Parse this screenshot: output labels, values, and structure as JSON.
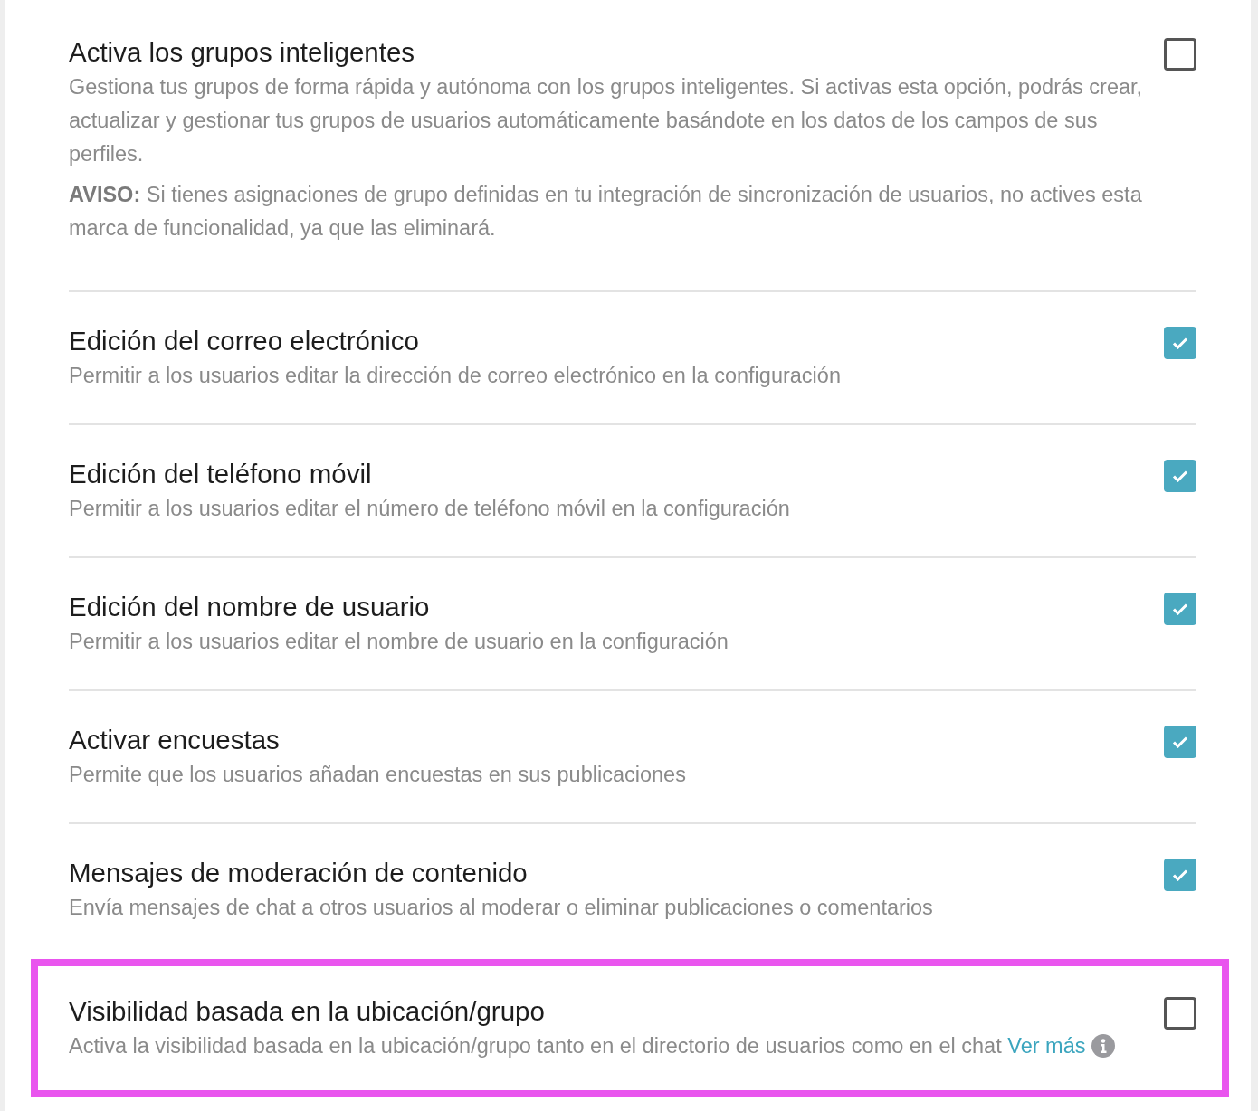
{
  "settings": [
    {
      "title": "Activa los grupos inteligentes",
      "description": "Gestiona tus grupos de forma rápida y autónoma con los grupos inteligentes. Si activas esta opción, podrás crear, actualizar y gestionar tus grupos de usuarios automáticamente basándote en los datos de los campos de sus perfiles.",
      "notice": "**AVISO:** Si tienes asignaciones de grupo definidas en tu integración de sincronización de usuarios, no actives esta marca de funcionalidad, ya que las eliminará.",
      "checked": false,
      "highlighted": false
    },
    {
      "title": "Edición del correo electrónico",
      "description": "Permitir a los usuarios editar la dirección de correo electrónico en la configuración",
      "checked": true,
      "highlighted": false
    },
    {
      "title": "Edición del teléfono móvil",
      "description": "Permitir a los usuarios editar el número de teléfono móvil en la configuración",
      "checked": true,
      "highlighted": false
    },
    {
      "title": "Edición del nombre de usuario",
      "description": "Permitir a los usuarios editar el nombre de usuario en la configuración",
      "checked": true,
      "highlighted": false
    },
    {
      "title": "Activar encuestas",
      "description": "Permite que los usuarios añadan encuestas en sus publicaciones",
      "checked": true,
      "highlighted": false
    },
    {
      "title": "Mensajes de moderación de contenido",
      "description": "Envía mensajes de chat a otros usuarios al moderar o eliminar publicaciones o comentarios",
      "checked": true,
      "highlighted": false
    },
    {
      "title": "Visibilidad basada en la ubicación/grupo",
      "description": "Activa la visibilidad basada en la ubicación/grupo tanto en el directorio de usuarios como en el chat",
      "link": "Ver más",
      "info": true,
      "checked": false,
      "highlighted": true
    }
  ]
}
